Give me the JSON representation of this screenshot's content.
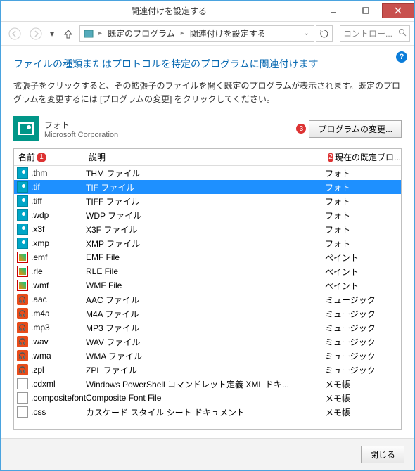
{
  "window_title": "関連付けを設定する",
  "breadcrumb": {
    "item1": "既定のプログラム",
    "item2": "関連付けを設定する"
  },
  "search_placeholder": "コントロー...",
  "heading": "ファイルの種類またはプロトコルを特定のプログラムに関連付けます",
  "desc": "拡張子をクリックすると、その拡張子のファイルを開く既定のプログラムが表示されます。既定のプログラムを変更するには [プログラムの変更] をクリックしてください。",
  "app": {
    "name": "フォト",
    "publisher": "Microsoft Corporation"
  },
  "change_btn": "プログラムの変更...",
  "markers": {
    "m1": "1",
    "m2": "2",
    "m3": "3"
  },
  "cols": {
    "name": "名前",
    "desc": "説明",
    "prog": "現在の既定プロ..."
  },
  "rows": [
    {
      "icon": "img",
      "ext": ".thm",
      "desc": "THM ファイル",
      "prog": "フォト",
      "sel": false
    },
    {
      "icon": "img",
      "ext": ".tif",
      "desc": "TIF ファイル",
      "prog": "フォト",
      "sel": true
    },
    {
      "icon": "img",
      "ext": ".tiff",
      "desc": "TIFF ファイル",
      "prog": "フォト",
      "sel": false
    },
    {
      "icon": "img",
      "ext": ".wdp",
      "desc": "WDP ファイル",
      "prog": "フォト",
      "sel": false
    },
    {
      "icon": "img",
      "ext": ".x3f",
      "desc": "X3F ファイル",
      "prog": "フォト",
      "sel": false
    },
    {
      "icon": "img",
      "ext": ".xmp",
      "desc": "XMP ファイル",
      "prog": "フォト",
      "sel": false
    },
    {
      "icon": "paint",
      "ext": ".emf",
      "desc": "EMF File",
      "prog": "ペイント",
      "sel": false
    },
    {
      "icon": "paint",
      "ext": ".rle",
      "desc": "RLE File",
      "prog": "ペイント",
      "sel": false
    },
    {
      "icon": "paint",
      "ext": ".wmf",
      "desc": "WMF File",
      "prog": "ペイント",
      "sel": false
    },
    {
      "icon": "music",
      "ext": ".aac",
      "desc": "AAC ファイル",
      "prog": "ミュージック",
      "sel": false
    },
    {
      "icon": "music",
      "ext": ".m4a",
      "desc": "M4A ファイル",
      "prog": "ミュージック",
      "sel": false
    },
    {
      "icon": "music",
      "ext": ".mp3",
      "desc": "MP3 ファイル",
      "prog": "ミュージック",
      "sel": false
    },
    {
      "icon": "music",
      "ext": ".wav",
      "desc": "WAV ファイル",
      "prog": "ミュージック",
      "sel": false
    },
    {
      "icon": "music",
      "ext": ".wma",
      "desc": "WMA ファイル",
      "prog": "ミュージック",
      "sel": false
    },
    {
      "icon": "music",
      "ext": ".zpl",
      "desc": "ZPL ファイル",
      "prog": "ミュージック",
      "sel": false
    },
    {
      "icon": "file",
      "ext": ".cdxml",
      "desc": "Windows PowerShell コマンドレット定義 XML ドキ...",
      "prog": "メモ帳",
      "sel": false
    },
    {
      "icon": "file",
      "ext": ".compositefont",
      "desc": "Composite Font File",
      "prog": "メモ帳",
      "sel": false
    },
    {
      "icon": "file",
      "ext": ".css",
      "desc": "カスケード スタイル シート ドキュメント",
      "prog": "メモ帳",
      "sel": false
    }
  ],
  "close_btn": "閉じる"
}
